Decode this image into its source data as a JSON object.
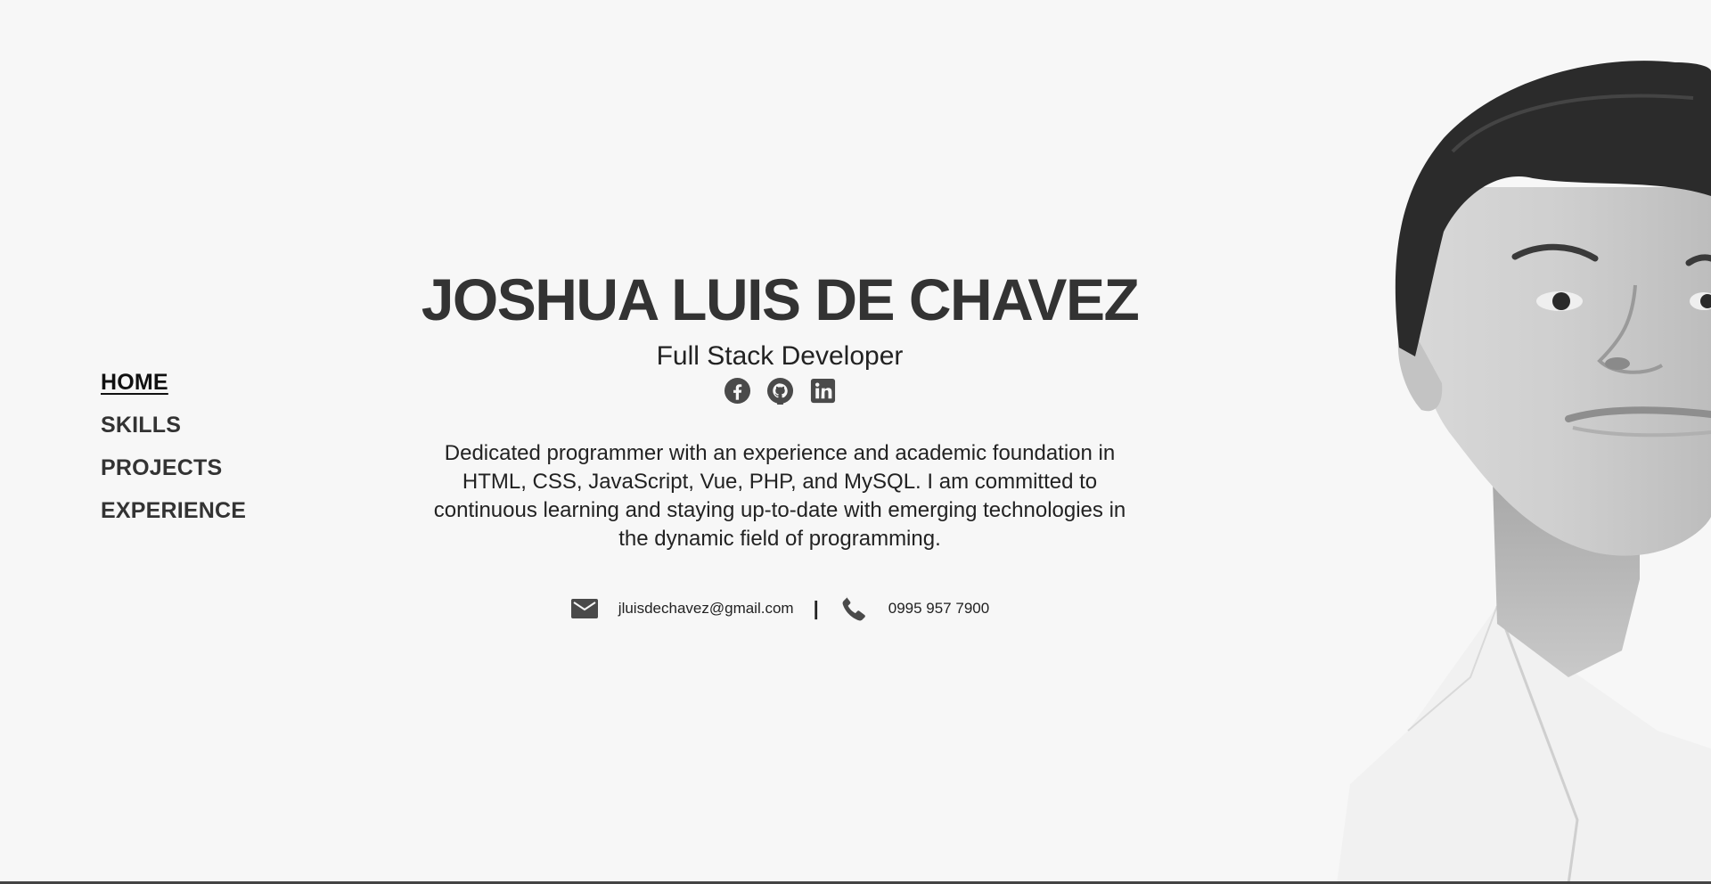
{
  "nav": {
    "items": [
      {
        "label": "HOME",
        "active": true
      },
      {
        "label": "SKILLS",
        "active": false
      },
      {
        "label": "PROJECTS",
        "active": false
      },
      {
        "label": "EXPERIENCE",
        "active": false
      }
    ]
  },
  "hero": {
    "name": "JOSHUA LUIS DE CHAVEZ",
    "role": "Full Stack Developer",
    "socials": [
      {
        "icon": "facebook-icon"
      },
      {
        "icon": "github-icon"
      },
      {
        "icon": "linkedin-icon"
      }
    ],
    "bio": "Dedicated programmer with an experience and academic foundation in HTML, CSS, JavaScript, Vue, PHP, and MySQL. I am committed to continuous learning and staying up-to-date with emerging technologies in the dynamic field of programming."
  },
  "contact": {
    "email_icon": "mail-icon",
    "email": "jluisdechavez@gmail.com",
    "separator": "|",
    "phone_icon": "phone-icon",
    "phone": "0995 957 7900"
  },
  "portrait": {
    "icon": "portrait-photo"
  },
  "colors": {
    "background": "#f7f7f7",
    "text": "#333333",
    "icon": "#4a4a4a"
  }
}
